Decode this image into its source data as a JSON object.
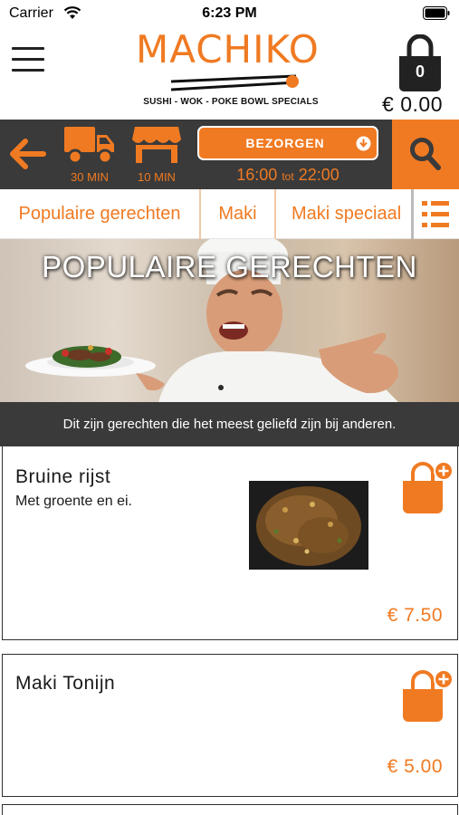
{
  "status_bar": {
    "carrier": "Carrier",
    "time": "6:23 PM"
  },
  "header": {
    "logo_text": "MACHIKO",
    "logo_tagline": "SUSHI - WOK - POKE BOWL SPECIALS",
    "cart_count": "0",
    "cart_total": "€ 0.00"
  },
  "toolbar": {
    "delivery_time": "30 MIN",
    "pickup_time": "10 MIN",
    "order_mode": "BEZORGEN",
    "hours_from": "16:00",
    "hours_sep": "tot",
    "hours_to": "22:00"
  },
  "tabs": [
    {
      "label": "Populaire gerechten"
    },
    {
      "label": "Maki"
    },
    {
      "label": "Maki speciaal"
    }
  ],
  "banner": {
    "title": "POPULAIRE GERECHTEN",
    "subtitle": "Dit zijn gerechten die het meest geliefd zijn bij anderen."
  },
  "products": [
    {
      "name": "Bruine rijst",
      "description": "Met groente en ei.",
      "price": "€ 7.50"
    },
    {
      "name": "Maki Tonijn",
      "description": "",
      "price": "€ 5.00"
    }
  ],
  "colors": {
    "accent": "#f07a22",
    "dark_bar": "#3a3a3a"
  }
}
